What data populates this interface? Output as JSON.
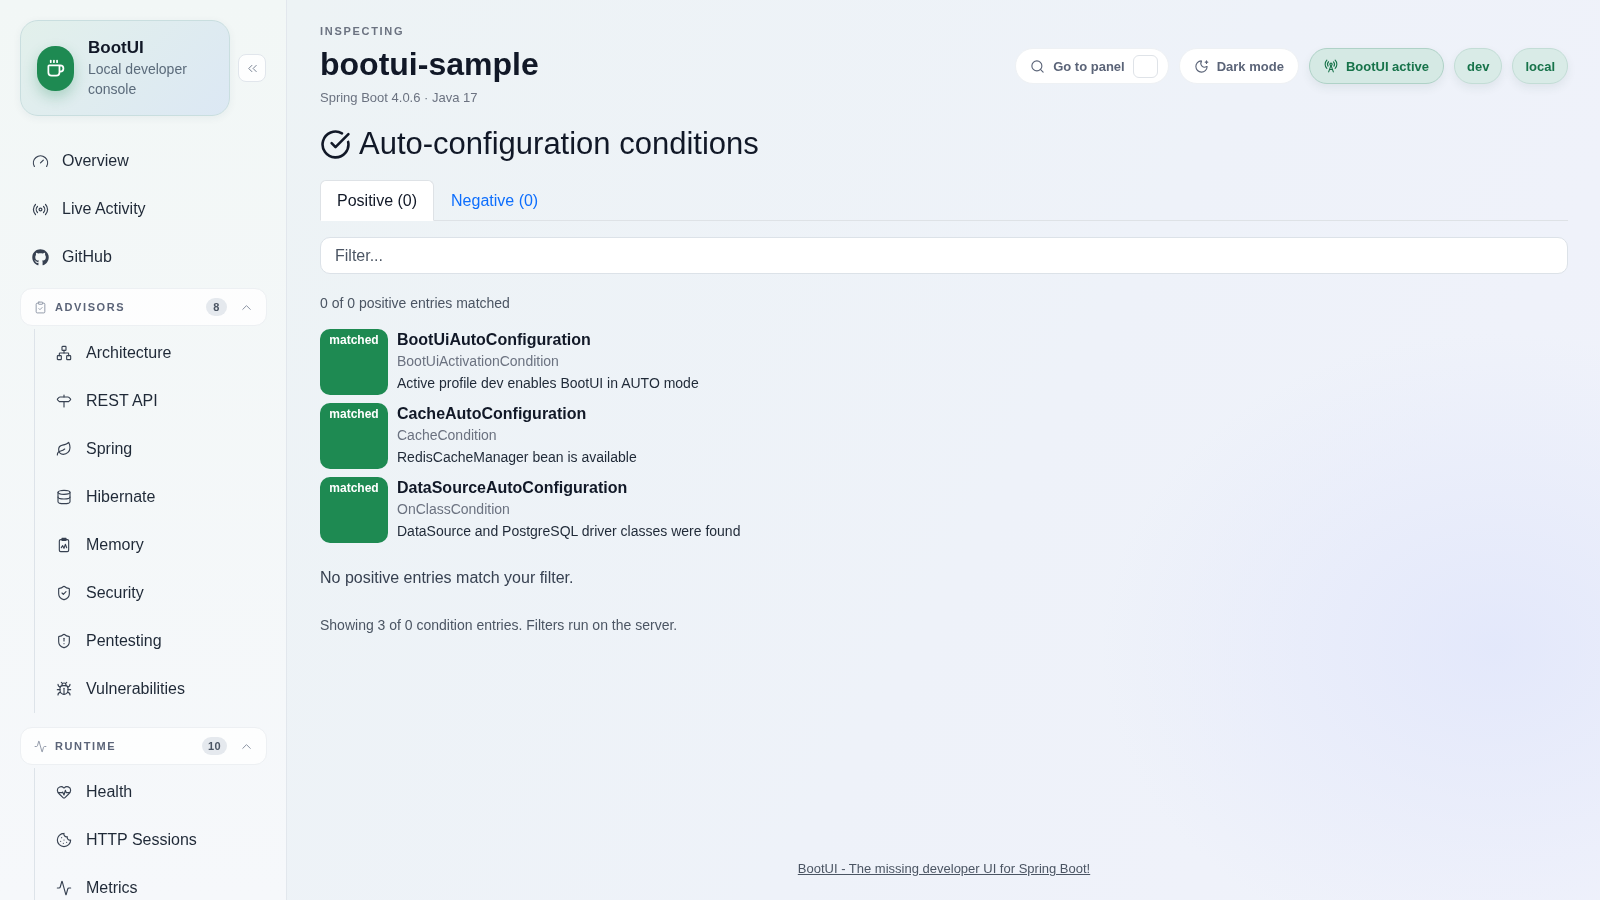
{
  "sidebar": {
    "brand": {
      "name": "BootUI",
      "subtitle": "Local developer console"
    },
    "nav": [
      {
        "label": "Overview"
      },
      {
        "label": "Live Activity"
      },
      {
        "label": "GitHub"
      }
    ],
    "sections": [
      {
        "title": "ADVISORS",
        "count": "8",
        "expanded": true,
        "items": [
          {
            "label": "Architecture"
          },
          {
            "label": "REST API"
          },
          {
            "label": "Spring"
          },
          {
            "label": "Hibernate"
          },
          {
            "label": "Memory"
          },
          {
            "label": "Security"
          },
          {
            "label": "Pentesting"
          },
          {
            "label": "Vulnerabilities"
          }
        ]
      },
      {
        "title": "RUNTIME",
        "count": "10",
        "expanded": true,
        "items": [
          {
            "label": "Health"
          },
          {
            "label": "HTTP Sessions"
          },
          {
            "label": "Metrics"
          }
        ]
      }
    ]
  },
  "header": {
    "eyebrow": "INSPECTING",
    "app_name": "bootui-sample",
    "versions": "Spring Boot 4.0.6 · Java 17",
    "actions": [
      {
        "kind": "search",
        "label": "Go to panel"
      },
      {
        "kind": "toggle",
        "label": "Dark mode"
      },
      {
        "kind": "status",
        "label": "BootUI active"
      },
      {
        "kind": "tag",
        "label": "dev"
      },
      {
        "kind": "tag",
        "label": "local"
      }
    ]
  },
  "page": {
    "title": "Auto-configuration conditions",
    "tabs": [
      {
        "label": "Positive (0)",
        "selected": true
      },
      {
        "label": "Negative (0)",
        "selected": false
      }
    ],
    "filter": {
      "placeholder": "Filter..."
    },
    "summary": "0 of 0 positive entries matched",
    "entries": [
      {
        "badge": "matched",
        "name": "BootUiAutoConfiguration",
        "condition": "BootUiActivationCondition",
        "message": "Active profile dev enables BootUI in AUTO mode"
      },
      {
        "badge": "matched",
        "name": "CacheAutoConfiguration",
        "condition": "CacheCondition",
        "message": "RedisCacheManager bean is available"
      },
      {
        "badge": "matched",
        "name": "DataSourceAutoConfiguration",
        "condition": "OnClassCondition",
        "message": "DataSource and PostgreSQL driver classes were found"
      }
    ],
    "empty_message": "No positive entries match your filter.",
    "footnote": "Showing 3 of 0 condition entries. Filters run on the server."
  },
  "footer": {
    "link": "BootUI - The missing developer UI for Spring Boot!"
  }
}
